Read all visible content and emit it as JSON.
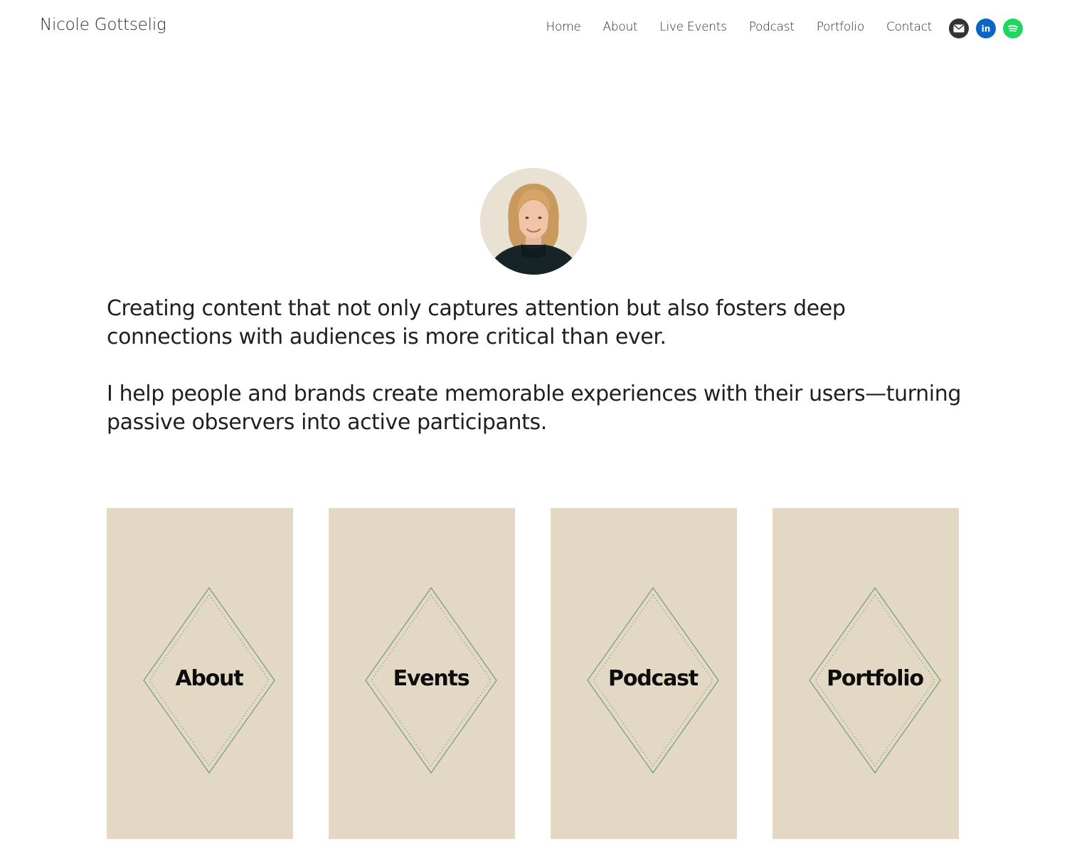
{
  "header": {
    "site_title": "Nicole Gottselig",
    "nav": [
      {
        "label": "Home"
      },
      {
        "label": "About"
      },
      {
        "label": "Live Events"
      },
      {
        "label": "Podcast"
      },
      {
        "label": "Portfolio"
      },
      {
        "label": "Contact"
      }
    ],
    "social": [
      {
        "icon": "mail-icon",
        "color": "#333333"
      },
      {
        "icon": "linkedin-icon",
        "color": "#0a66c2",
        "glyph": "in"
      },
      {
        "icon": "spotify-icon",
        "color": "#1ed760"
      }
    ]
  },
  "hero": {
    "avatar_alt": "Portrait of Nicole Gottselig",
    "paragraphs": [
      "Creating content that not only captures attention but also fosters deep connections with audiences is more critical than ever.",
      "I help people and brands create memorable experiences with their users—turning passive observers into active participants."
    ]
  },
  "cards": [
    {
      "label": "About"
    },
    {
      "label": "Events"
    },
    {
      "label": "Podcast"
    },
    {
      "label": "Portfolio"
    }
  ],
  "colors": {
    "card_background": "#e2d8c3",
    "diamond_stroke": "#6a9a6a"
  }
}
